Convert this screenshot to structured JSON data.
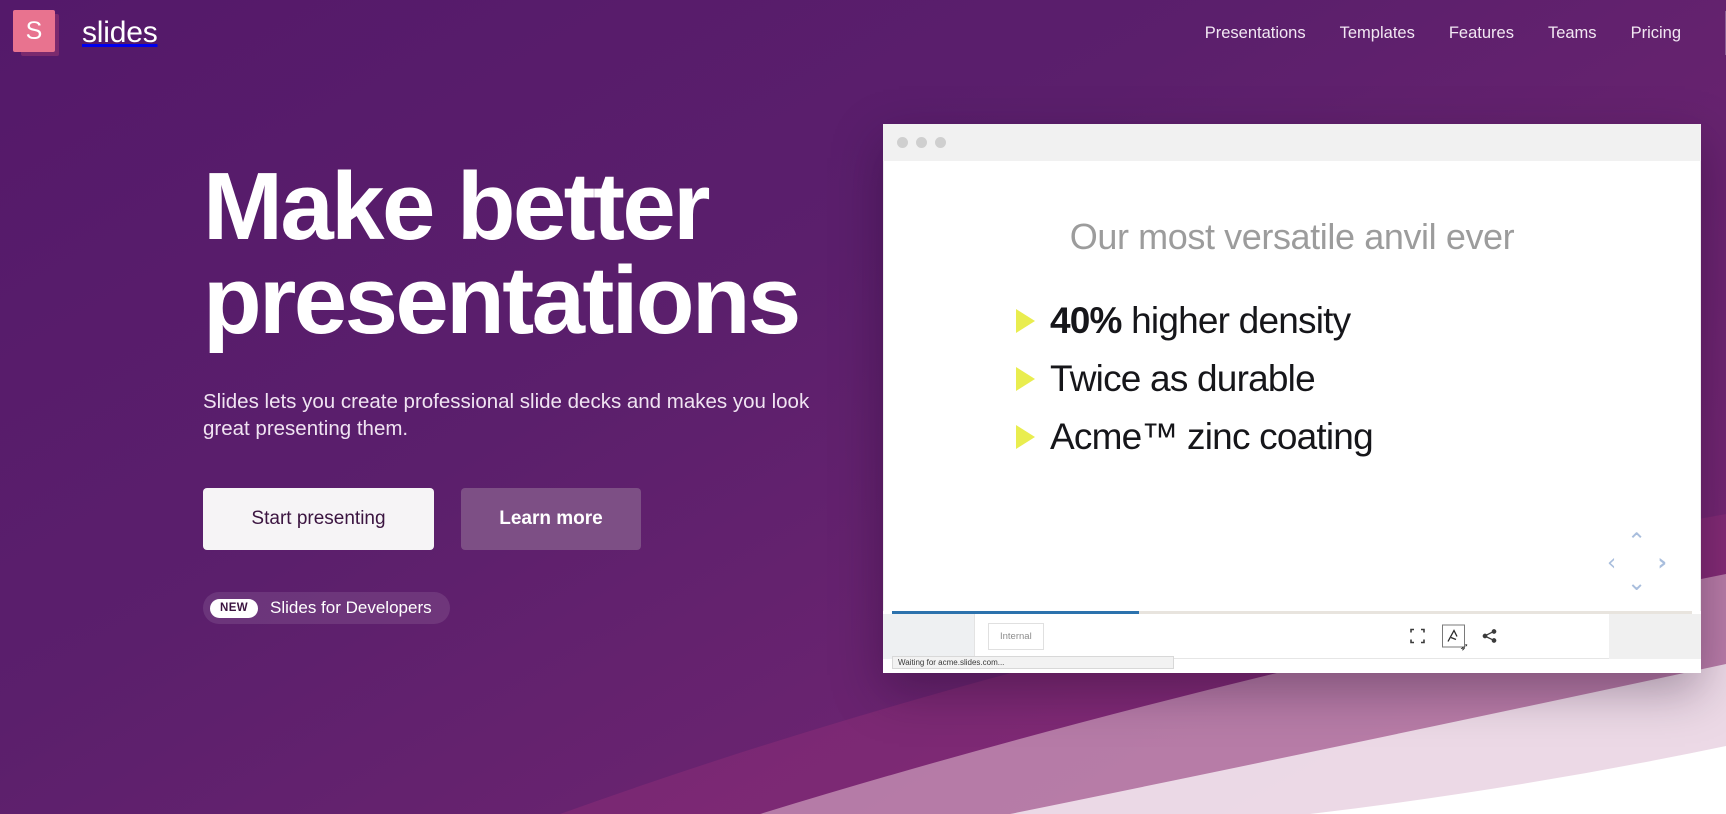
{
  "brand": {
    "mark": "S",
    "name": "slides"
  },
  "nav": {
    "links": [
      {
        "label": "Presentations"
      },
      {
        "label": "Templates"
      },
      {
        "label": "Features"
      },
      {
        "label": "Teams"
      },
      {
        "label": "Pricing"
      }
    ]
  },
  "hero": {
    "heading": "Make better presentations",
    "subheading": "Slides lets you create professional slide decks and makes you look great presenting them.",
    "primary_button": "Start presenting",
    "secondary_button": "Learn more",
    "badge_tag": "NEW",
    "badge_label": "Slides for Developers"
  },
  "browser": {
    "window_dots": 3,
    "slide": {
      "title": "Our most versatile anvil ever",
      "bullets": [
        {
          "bold": "40%",
          "rest": " higher density"
        },
        {
          "bold": "",
          "rest": "Twice as durable"
        },
        {
          "bold": "",
          "rest": "Acme™ zinc coating"
        }
      ]
    },
    "nav_pad": {
      "up": "⌃",
      "down": "⌄",
      "left": "‹",
      "right": "›"
    },
    "toolbar": {
      "tab_label": "Internal",
      "status_text": "Waiting for acme.slides.com...",
      "icons": [
        "fullscreen-icon",
        "pen-tool-icon",
        "share-icon"
      ]
    }
  },
  "colors": {
    "brand_purple": "#5a1f68",
    "logo_pink": "#e8738f",
    "bullet_yellow": "#e9ed4f",
    "progress_blue": "#2c72ad",
    "nav_active_blue": "#2b5ca5"
  }
}
